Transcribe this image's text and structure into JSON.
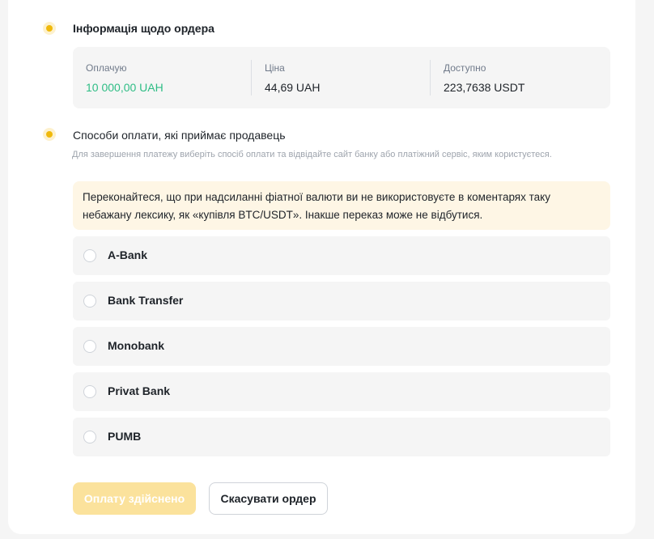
{
  "order_info": {
    "title": "Інформація щодо ордера",
    "pay": {
      "label": "Оплачую",
      "value": "10 000,00 UAH"
    },
    "price": {
      "label": "Ціна",
      "value": "44,69 UAH"
    },
    "available": {
      "label": "Доступно",
      "value": "223,7638 USDT"
    }
  },
  "payment_methods": {
    "title": "Способи оплати, які приймає продавець",
    "hint": "Для завершення платежу виберіть спосіб оплати та відвідайте сайт банку або платіжний сервіс, яким користуєтеся.",
    "warning": "Переконайтеся, що при надсиланні фіатної валюти ви не використовуєте в коментарях таку небажану лексику, як «купівля BTC/USDT». Інакше переказ може не відбутися.",
    "options": [
      "A-Bank",
      "Bank Transfer",
      "Monobank",
      "Privat Bank",
      "PUMB"
    ]
  },
  "actions": {
    "done_label": "Оплату здійснено",
    "cancel_label": "Скасувати ордер"
  },
  "colors": {
    "accent": "#f0b90b",
    "positive": "#2ebd85",
    "warning_bg": "#fef6e5",
    "disabled_button": "#fbe29c"
  }
}
